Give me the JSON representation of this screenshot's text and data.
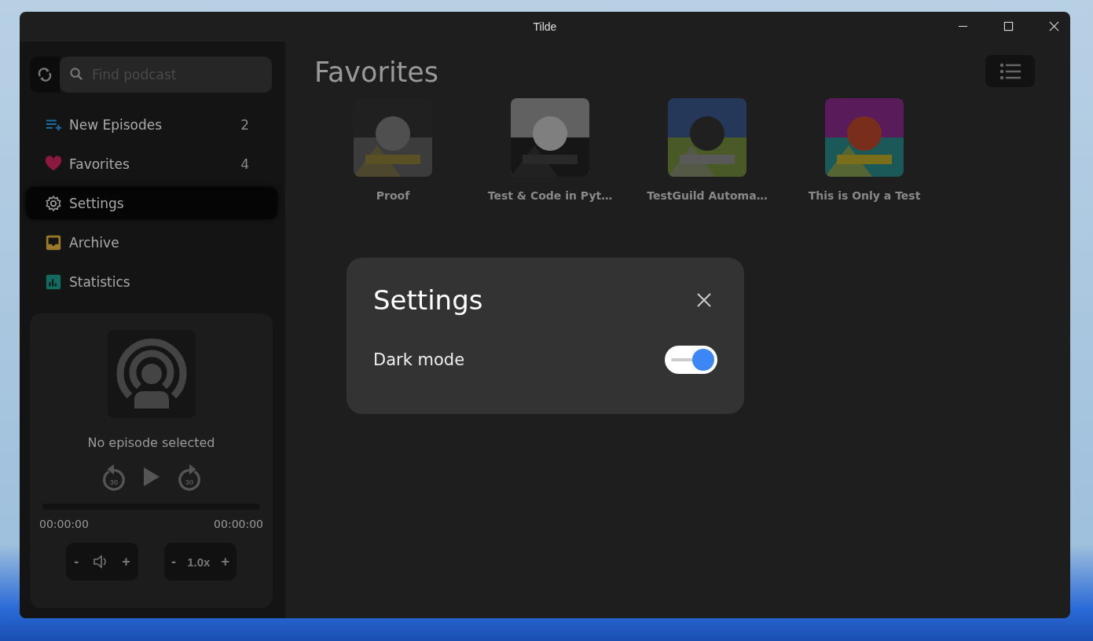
{
  "window": {
    "title": "Tilde"
  },
  "search": {
    "placeholder": "Find podcast"
  },
  "sidebar": {
    "items": [
      {
        "kind": "new",
        "label": "New Episodes",
        "count": "2",
        "selected": false
      },
      {
        "kind": "heart",
        "label": "Favorites",
        "count": "4",
        "selected": false
      },
      {
        "kind": "gear",
        "label": "Settings",
        "selected": true
      },
      {
        "kind": "archive",
        "label": "Archive",
        "selected": false
      },
      {
        "kind": "stats",
        "label": "Statistics",
        "selected": false
      }
    ]
  },
  "player": {
    "title": "No episode selected",
    "rewind": "30",
    "forward": "30",
    "progress": {
      "level": 0
    },
    "elapsed": "00:00:00",
    "duration": "00:00:00",
    "volume": {
      "minus": "-",
      "plus": "+"
    },
    "speed": {
      "minus": "-",
      "value": "1.0x",
      "plus": "+"
    }
  },
  "main": {
    "heading": "Favorites",
    "podcasts": [
      {
        "kind": "picture",
        "title": "Proof"
      },
      {
        "kind": "picture",
        "title": "Test & Code in Pyt…"
      },
      {
        "kind": "picture",
        "title": "TestGuild Automa…"
      },
      {
        "kind": "picture",
        "title": "This is Only a Test"
      }
    ]
  },
  "dialog": {
    "title": "Settings",
    "options": [
      {
        "label": "Dark mode",
        "on": true
      }
    ]
  }
}
